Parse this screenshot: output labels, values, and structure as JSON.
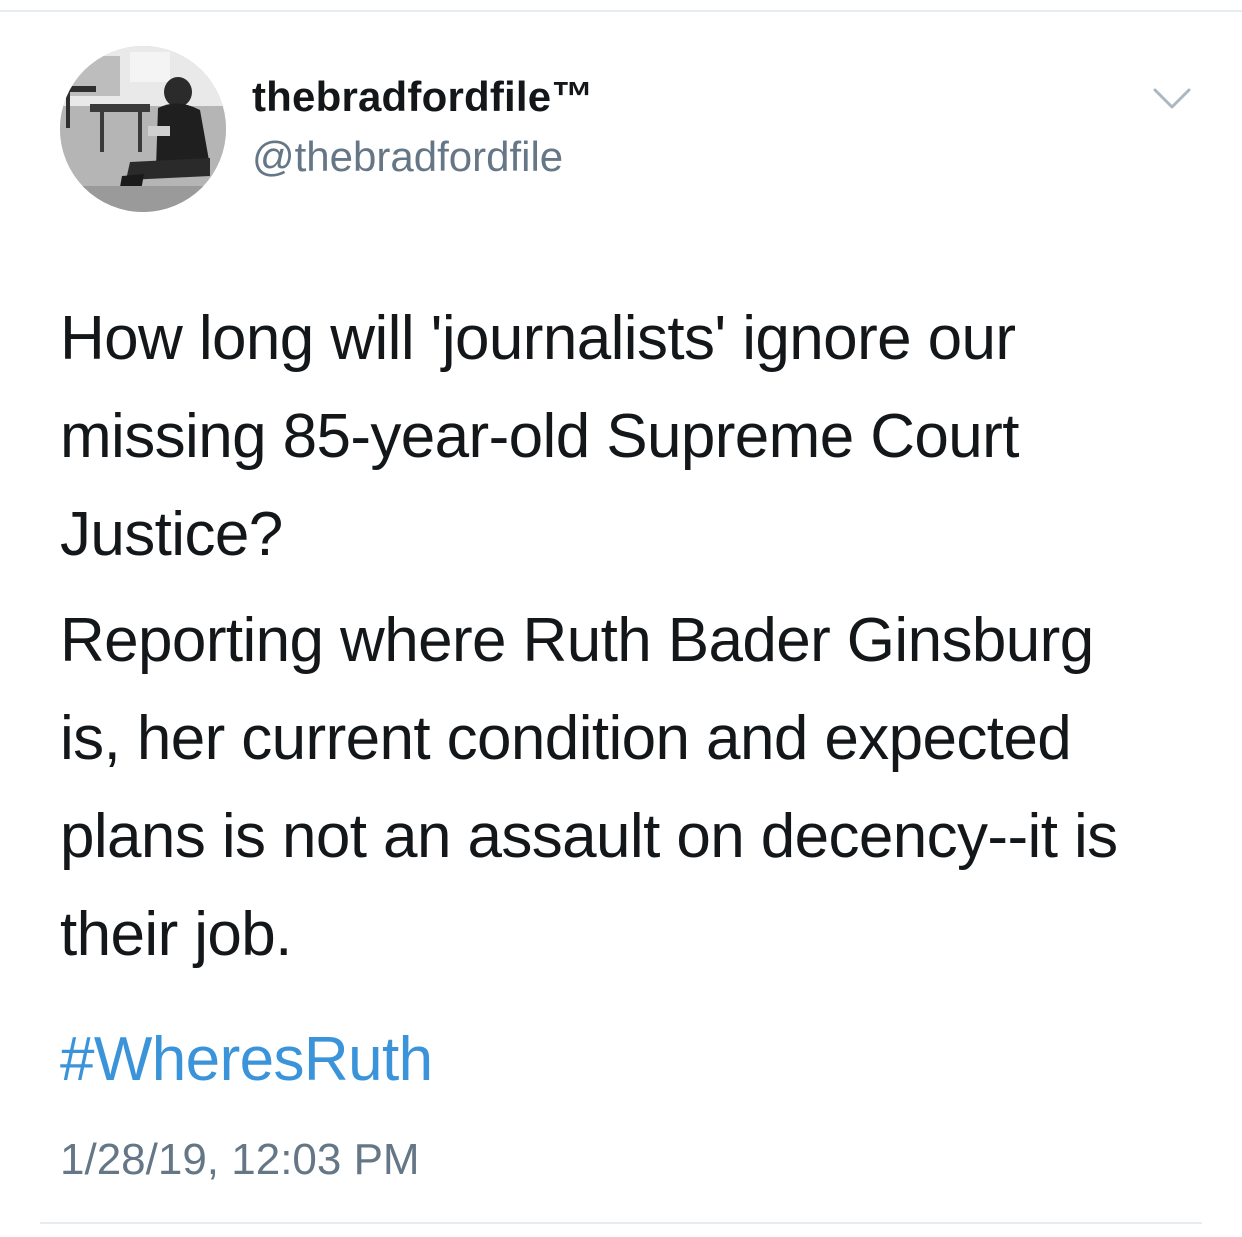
{
  "tweet": {
    "author": {
      "display_name": "thebradfordfile™",
      "handle": "@thebradfordfile",
      "avatar": "profile-photo-icon"
    },
    "menu_icon": "chevron-down-icon",
    "paragraphs": [
      {
        "lines": [
          "How long will 'journalists' ignore our",
          "missing 85-year-old Supreme Court",
          "Justice?"
        ]
      },
      {
        "lines": [
          "Reporting where Ruth Bader Ginsburg",
          "is, her current condition and expected",
          "plans is not an assault on decency--it is",
          "their job."
        ]
      }
    ],
    "hashtag": "#WheresRuth",
    "timestamp": "1/28/19, 12:03 PM"
  },
  "colors": {
    "text": "#14171a",
    "secondary_text": "#657786",
    "link": "#3b94d9",
    "divider": "#e6ecf0"
  }
}
